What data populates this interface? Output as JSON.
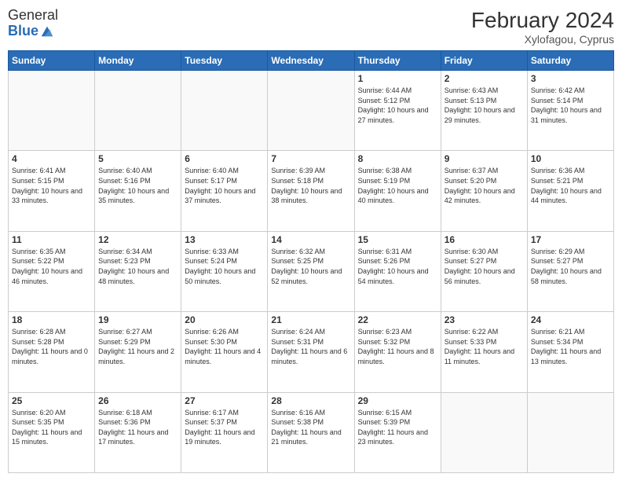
{
  "logo": {
    "general": "General",
    "blue": "Blue"
  },
  "title": "February 2024",
  "subtitle": "Xylofagou, Cyprus",
  "headers": [
    "Sunday",
    "Monday",
    "Tuesday",
    "Wednesday",
    "Thursday",
    "Friday",
    "Saturday"
  ],
  "weeks": [
    [
      {
        "day": "",
        "info": ""
      },
      {
        "day": "",
        "info": ""
      },
      {
        "day": "",
        "info": ""
      },
      {
        "day": "",
        "info": ""
      },
      {
        "day": "1",
        "info": "Sunrise: 6:44 AM\nSunset: 5:12 PM\nDaylight: 10 hours and 27 minutes."
      },
      {
        "day": "2",
        "info": "Sunrise: 6:43 AM\nSunset: 5:13 PM\nDaylight: 10 hours and 29 minutes."
      },
      {
        "day": "3",
        "info": "Sunrise: 6:42 AM\nSunset: 5:14 PM\nDaylight: 10 hours and 31 minutes."
      }
    ],
    [
      {
        "day": "4",
        "info": "Sunrise: 6:41 AM\nSunset: 5:15 PM\nDaylight: 10 hours and 33 minutes."
      },
      {
        "day": "5",
        "info": "Sunrise: 6:40 AM\nSunset: 5:16 PM\nDaylight: 10 hours and 35 minutes."
      },
      {
        "day": "6",
        "info": "Sunrise: 6:40 AM\nSunset: 5:17 PM\nDaylight: 10 hours and 37 minutes."
      },
      {
        "day": "7",
        "info": "Sunrise: 6:39 AM\nSunset: 5:18 PM\nDaylight: 10 hours and 38 minutes."
      },
      {
        "day": "8",
        "info": "Sunrise: 6:38 AM\nSunset: 5:19 PM\nDaylight: 10 hours and 40 minutes."
      },
      {
        "day": "9",
        "info": "Sunrise: 6:37 AM\nSunset: 5:20 PM\nDaylight: 10 hours and 42 minutes."
      },
      {
        "day": "10",
        "info": "Sunrise: 6:36 AM\nSunset: 5:21 PM\nDaylight: 10 hours and 44 minutes."
      }
    ],
    [
      {
        "day": "11",
        "info": "Sunrise: 6:35 AM\nSunset: 5:22 PM\nDaylight: 10 hours and 46 minutes."
      },
      {
        "day": "12",
        "info": "Sunrise: 6:34 AM\nSunset: 5:23 PM\nDaylight: 10 hours and 48 minutes."
      },
      {
        "day": "13",
        "info": "Sunrise: 6:33 AM\nSunset: 5:24 PM\nDaylight: 10 hours and 50 minutes."
      },
      {
        "day": "14",
        "info": "Sunrise: 6:32 AM\nSunset: 5:25 PM\nDaylight: 10 hours and 52 minutes."
      },
      {
        "day": "15",
        "info": "Sunrise: 6:31 AM\nSunset: 5:26 PM\nDaylight: 10 hours and 54 minutes."
      },
      {
        "day": "16",
        "info": "Sunrise: 6:30 AM\nSunset: 5:27 PM\nDaylight: 10 hours and 56 minutes."
      },
      {
        "day": "17",
        "info": "Sunrise: 6:29 AM\nSunset: 5:27 PM\nDaylight: 10 hours and 58 minutes."
      }
    ],
    [
      {
        "day": "18",
        "info": "Sunrise: 6:28 AM\nSunset: 5:28 PM\nDaylight: 11 hours and 0 minutes."
      },
      {
        "day": "19",
        "info": "Sunrise: 6:27 AM\nSunset: 5:29 PM\nDaylight: 11 hours and 2 minutes."
      },
      {
        "day": "20",
        "info": "Sunrise: 6:26 AM\nSunset: 5:30 PM\nDaylight: 11 hours and 4 minutes."
      },
      {
        "day": "21",
        "info": "Sunrise: 6:24 AM\nSunset: 5:31 PM\nDaylight: 11 hours and 6 minutes."
      },
      {
        "day": "22",
        "info": "Sunrise: 6:23 AM\nSunset: 5:32 PM\nDaylight: 11 hours and 8 minutes."
      },
      {
        "day": "23",
        "info": "Sunrise: 6:22 AM\nSunset: 5:33 PM\nDaylight: 11 hours and 11 minutes."
      },
      {
        "day": "24",
        "info": "Sunrise: 6:21 AM\nSunset: 5:34 PM\nDaylight: 11 hours and 13 minutes."
      }
    ],
    [
      {
        "day": "25",
        "info": "Sunrise: 6:20 AM\nSunset: 5:35 PM\nDaylight: 11 hours and 15 minutes."
      },
      {
        "day": "26",
        "info": "Sunrise: 6:18 AM\nSunset: 5:36 PM\nDaylight: 11 hours and 17 minutes."
      },
      {
        "day": "27",
        "info": "Sunrise: 6:17 AM\nSunset: 5:37 PM\nDaylight: 11 hours and 19 minutes."
      },
      {
        "day": "28",
        "info": "Sunrise: 6:16 AM\nSunset: 5:38 PM\nDaylight: 11 hours and 21 minutes."
      },
      {
        "day": "29",
        "info": "Sunrise: 6:15 AM\nSunset: 5:39 PM\nDaylight: 11 hours and 23 minutes."
      },
      {
        "day": "",
        "info": ""
      },
      {
        "day": "",
        "info": ""
      }
    ]
  ]
}
